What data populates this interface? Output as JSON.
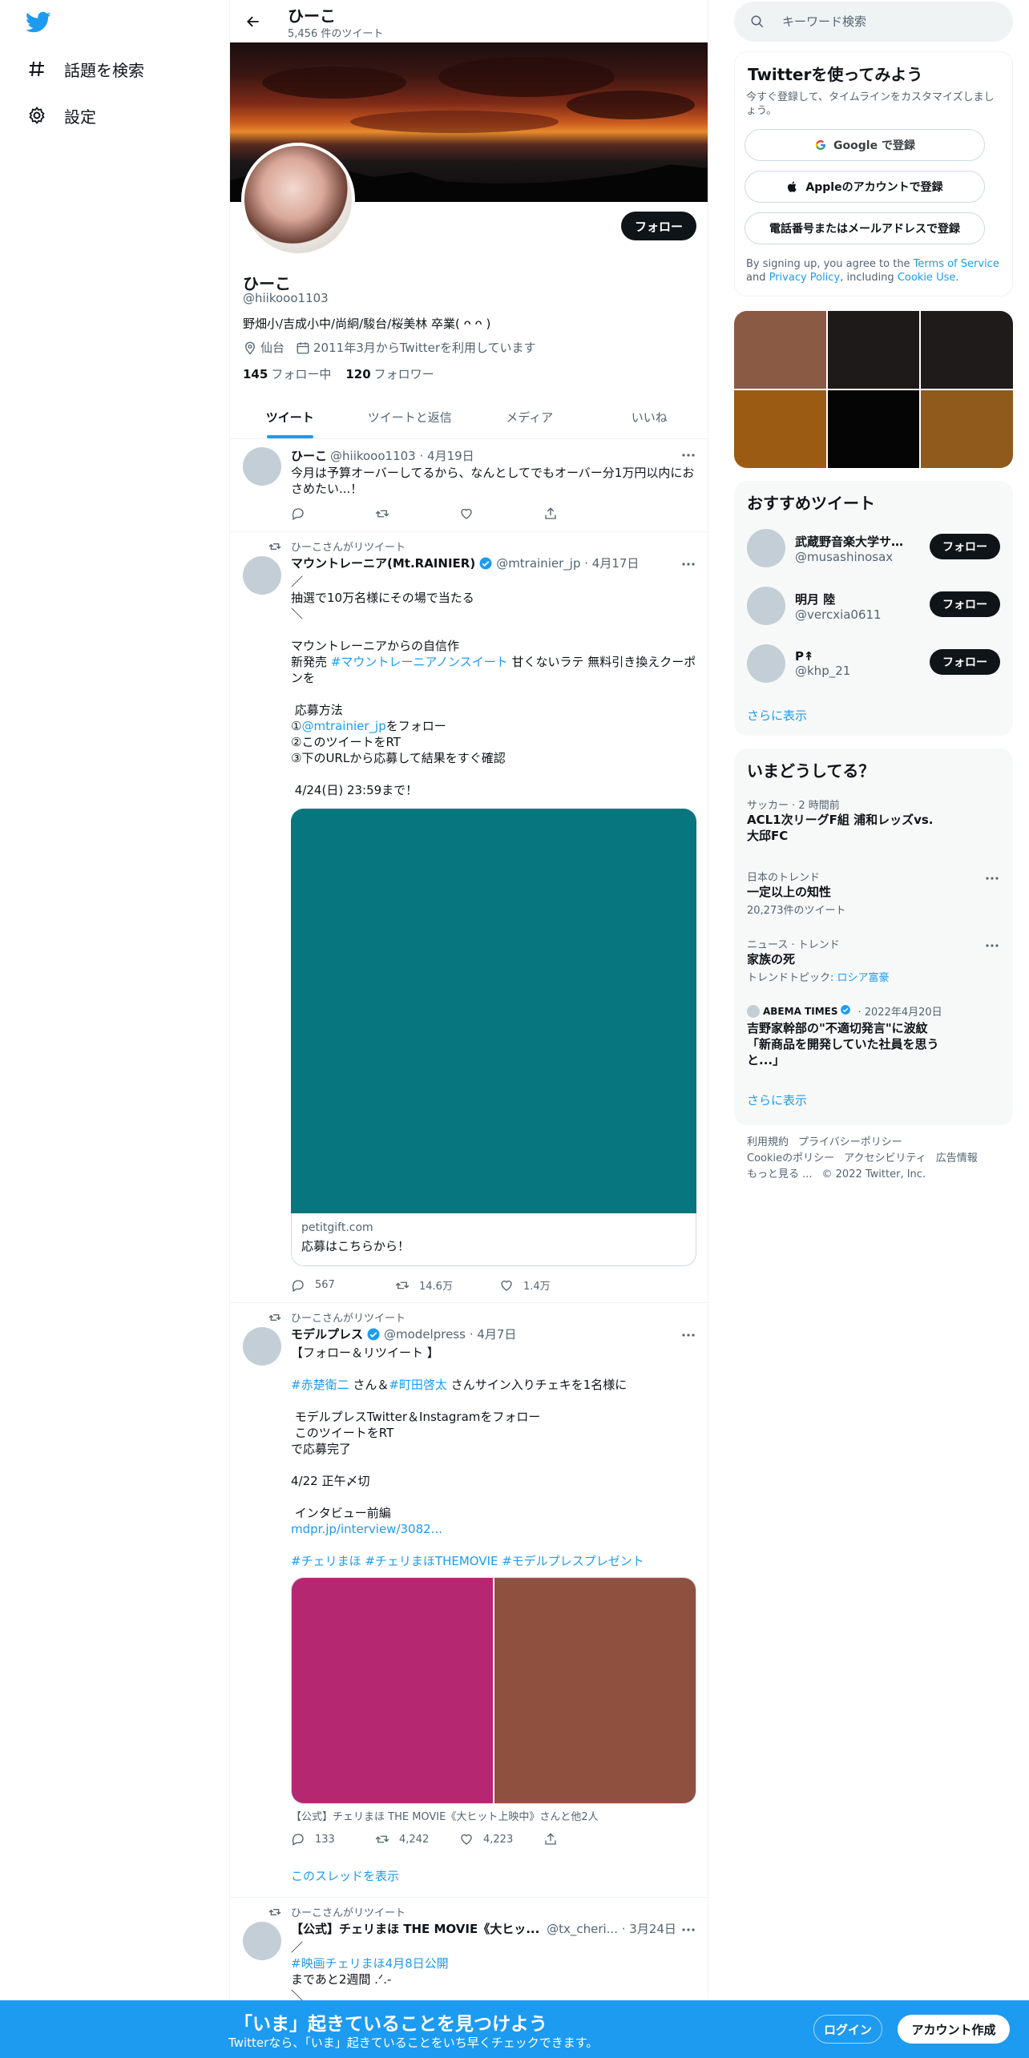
{
  "nav": {
    "explore_label": "話題を検索",
    "settings_label": "設定"
  },
  "header": {
    "name": "ひーこ",
    "tweet_count": "5,456 件のツイート"
  },
  "profile": {
    "follow_label": "フォロー",
    "name": "ひーこ",
    "handle": "@hiikooo1103",
    "bio": "野畑小/吉成小中/尚絅/駿台/桜美林 卒業( ᴖ ᴖ )",
    "location": "仙台",
    "joined": "2011年3月からTwitterを利用しています",
    "following_count": "145",
    "following_label": "フォロー中",
    "followers_count": "120",
    "followers_label": "フォロワー"
  },
  "tabs": [
    "ツイート",
    "ツイートと返信",
    "メディア",
    "いいね"
  ],
  "tweets": [
    {
      "name": "ひーこ",
      "handle": "@hiikooo1103",
      "date": "· 4月19日",
      "text": "今月は予算オーバーしてるから、なんとしてでもオーバー分1万円以内におさめたい...！",
      "replies": "",
      "retweets": "",
      "likes": ""
    },
    {
      "retweet_by": "ひーこさんがリツイート",
      "name": "マウントレーニア(Mt.RAINIER)",
      "handle": "@mtrainier_jp",
      "date": "· 4月17日",
      "text_a": "／\n抽選で10万名様にその場で当たる\n＼\n\nマウントレーニアからの自信作\n新発売 ",
      "hashtag": "#マウントレーニアノンスイート",
      "text_b": " 甘くないラテ 無料引き換えクーポンを\n\n 応募方法\n①",
      "mention": "@mtrainier_jp",
      "text_c": "をフォロー\n②このツイートをRT\n③下のURLから応募して結果をすぐ確認\n\n 4/24(日) 23:59まで！",
      "card_domain": "petitgift.com",
      "card_title": "応募はこちらから！",
      "replies": "567",
      "retweets": "14.6万",
      "likes": "1.4万"
    },
    {
      "retweet_by": "ひーこさんがリツイート",
      "name": "モデルプレス",
      "handle": "@modelpress",
      "date": "· 4月7日",
      "line1": "【フォロー＆リツイート 】",
      "tag1": "#赤楚衛二",
      "mid1": " さん＆",
      "tag2": "#町田啓太",
      "mid2": " さんサイン入りチェキを1名様に",
      "line2": " モデルプレスTwitter＆Instagramをフォロー\n このツイートをRT\nで応募完了\n\n4/22 正午〆切\n\n インタビュー前編",
      "link": "mdpr.jp/interview/3082...",
      "tags": "#チェリまほ #チェリまほTHEMOVIE #モデルプレスプレゼント",
      "caption": "【公式】チェリまほ THE MOVIE《大ヒット上映中》さんと他2人",
      "replies": "133",
      "retweets": "4,242",
      "likes": "4,223",
      "show_thread": "このスレッドを表示"
    },
    {
      "retweet_by": "ひーこさんがリツイート",
      "name": "【公式】チェリまほ THE MOVIE《大ヒッ...",
      "handle": "@tx_cheri...",
      "date": "· 3月24日",
      "line1": "／",
      "tag": "#映画チェリまほ4月8日公開",
      "line2": "まであと2週間 .ᐟ.-\n＼"
    }
  ],
  "right": {
    "search_placeholder": "キーワード検索",
    "signup_title": "Twitterを使ってみよう",
    "signup_sub": "今すぐ登録して、タイムラインをカスタマイズしましょう。",
    "google_label": "Google で登録",
    "apple_label": "Appleのアカウントで登録",
    "phone_label": "電話番号またはメールアドレスで登録",
    "legal_a": "By signing up, you agree to the ",
    "terms": "Terms of Service",
    "legal_b": " and ",
    "privacy": "Privacy Policy",
    "legal_c": ", including ",
    "cookie": "Cookie Use",
    "legal_d": ".",
    "rec_title": "おすすめツイート",
    "recs": [
      {
        "name": "武蔵野音楽大学サク...",
        "handle": "@musashinosax",
        "button": "フォロー"
      },
      {
        "name": "明月 陸",
        "handle": "@vercxia0611",
        "button": "フォロー"
      },
      {
        "name": "P↟",
        "handle": "@khp_21",
        "button": "フォロー"
      }
    ],
    "show_more": "さらに表示",
    "trends_title": "いまどうしてる？",
    "trends": [
      {
        "context": "サッカー · 2 時間前",
        "title": "ACL1次リーグF組 浦和レッズvs.大邱FC"
      },
      {
        "context": "日本のトレンド",
        "title": "一定以上の知性",
        "count": "20,273件のツイート"
      },
      {
        "context": "ニュース · トレンド",
        "title": "家族の死",
        "topic_label": "トレンドトピック: ",
        "topic": "ロシア富豪"
      },
      {
        "source": "ABEMA TIMES",
        "date": "· 2022年4月20日",
        "title": "吉野家幹部の\"不適切発言\"に波紋「新商品を開発していた社員を思うと...」"
      }
    ],
    "trends_more": "さらに表示",
    "footer": [
      "利用規約",
      "プライバシーポリシー",
      "Cookieのポリシー",
      "アクセシビリティ",
      "広告情報",
      "もっと見る ...",
      "© 2022 Twitter, Inc."
    ]
  },
  "bottom": {
    "title": "「いま」起きていることを見つけよう",
    "sub": "Twitterなら、「いま」起きていることをいち早くチェックできます。",
    "login": "ログイン",
    "signup": "アカウント作成"
  },
  "colors": {
    "accent": "#1d9bf0",
    "media1": "#07767e",
    "media2_left": "#b52771",
    "media2_right": "#8f503f",
    "grid": [
      "#8a5a44",
      "#1e1a19",
      "#1f1b1a",
      "#9c5b13",
      "#050505",
      "#8f5a1c"
    ]
  }
}
